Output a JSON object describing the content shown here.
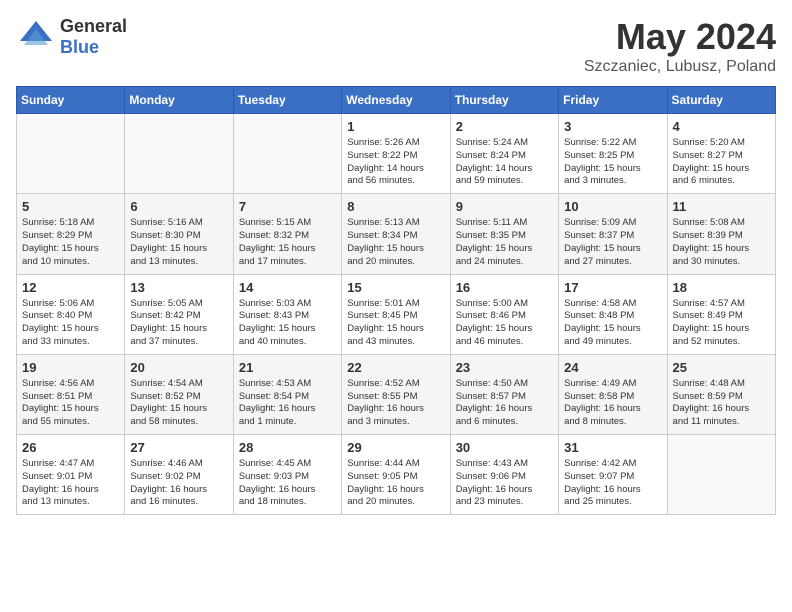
{
  "header": {
    "logo_general": "General",
    "logo_blue": "Blue",
    "title": "May 2024",
    "location": "Szczaniec, Lubusz, Poland"
  },
  "weekdays": [
    "Sunday",
    "Monday",
    "Tuesday",
    "Wednesday",
    "Thursday",
    "Friday",
    "Saturday"
  ],
  "weeks": [
    [
      {
        "day": "",
        "info": ""
      },
      {
        "day": "",
        "info": ""
      },
      {
        "day": "",
        "info": ""
      },
      {
        "day": "1",
        "info": "Sunrise: 5:26 AM\nSunset: 8:22 PM\nDaylight: 14 hours\nand 56 minutes."
      },
      {
        "day": "2",
        "info": "Sunrise: 5:24 AM\nSunset: 8:24 PM\nDaylight: 14 hours\nand 59 minutes."
      },
      {
        "day": "3",
        "info": "Sunrise: 5:22 AM\nSunset: 8:25 PM\nDaylight: 15 hours\nand 3 minutes."
      },
      {
        "day": "4",
        "info": "Sunrise: 5:20 AM\nSunset: 8:27 PM\nDaylight: 15 hours\nand 6 minutes."
      }
    ],
    [
      {
        "day": "5",
        "info": "Sunrise: 5:18 AM\nSunset: 8:29 PM\nDaylight: 15 hours\nand 10 minutes."
      },
      {
        "day": "6",
        "info": "Sunrise: 5:16 AM\nSunset: 8:30 PM\nDaylight: 15 hours\nand 13 minutes."
      },
      {
        "day": "7",
        "info": "Sunrise: 5:15 AM\nSunset: 8:32 PM\nDaylight: 15 hours\nand 17 minutes."
      },
      {
        "day": "8",
        "info": "Sunrise: 5:13 AM\nSunset: 8:34 PM\nDaylight: 15 hours\nand 20 minutes."
      },
      {
        "day": "9",
        "info": "Sunrise: 5:11 AM\nSunset: 8:35 PM\nDaylight: 15 hours\nand 24 minutes."
      },
      {
        "day": "10",
        "info": "Sunrise: 5:09 AM\nSunset: 8:37 PM\nDaylight: 15 hours\nand 27 minutes."
      },
      {
        "day": "11",
        "info": "Sunrise: 5:08 AM\nSunset: 8:39 PM\nDaylight: 15 hours\nand 30 minutes."
      }
    ],
    [
      {
        "day": "12",
        "info": "Sunrise: 5:06 AM\nSunset: 8:40 PM\nDaylight: 15 hours\nand 33 minutes."
      },
      {
        "day": "13",
        "info": "Sunrise: 5:05 AM\nSunset: 8:42 PM\nDaylight: 15 hours\nand 37 minutes."
      },
      {
        "day": "14",
        "info": "Sunrise: 5:03 AM\nSunset: 8:43 PM\nDaylight: 15 hours\nand 40 minutes."
      },
      {
        "day": "15",
        "info": "Sunrise: 5:01 AM\nSunset: 8:45 PM\nDaylight: 15 hours\nand 43 minutes."
      },
      {
        "day": "16",
        "info": "Sunrise: 5:00 AM\nSunset: 8:46 PM\nDaylight: 15 hours\nand 46 minutes."
      },
      {
        "day": "17",
        "info": "Sunrise: 4:58 AM\nSunset: 8:48 PM\nDaylight: 15 hours\nand 49 minutes."
      },
      {
        "day": "18",
        "info": "Sunrise: 4:57 AM\nSunset: 8:49 PM\nDaylight: 15 hours\nand 52 minutes."
      }
    ],
    [
      {
        "day": "19",
        "info": "Sunrise: 4:56 AM\nSunset: 8:51 PM\nDaylight: 15 hours\nand 55 minutes."
      },
      {
        "day": "20",
        "info": "Sunrise: 4:54 AM\nSunset: 8:52 PM\nDaylight: 15 hours\nand 58 minutes."
      },
      {
        "day": "21",
        "info": "Sunrise: 4:53 AM\nSunset: 8:54 PM\nDaylight: 16 hours\nand 1 minute."
      },
      {
        "day": "22",
        "info": "Sunrise: 4:52 AM\nSunset: 8:55 PM\nDaylight: 16 hours\nand 3 minutes."
      },
      {
        "day": "23",
        "info": "Sunrise: 4:50 AM\nSunset: 8:57 PM\nDaylight: 16 hours\nand 6 minutes."
      },
      {
        "day": "24",
        "info": "Sunrise: 4:49 AM\nSunset: 8:58 PM\nDaylight: 16 hours\nand 8 minutes."
      },
      {
        "day": "25",
        "info": "Sunrise: 4:48 AM\nSunset: 8:59 PM\nDaylight: 16 hours\nand 11 minutes."
      }
    ],
    [
      {
        "day": "26",
        "info": "Sunrise: 4:47 AM\nSunset: 9:01 PM\nDaylight: 16 hours\nand 13 minutes."
      },
      {
        "day": "27",
        "info": "Sunrise: 4:46 AM\nSunset: 9:02 PM\nDaylight: 16 hours\nand 16 minutes."
      },
      {
        "day": "28",
        "info": "Sunrise: 4:45 AM\nSunset: 9:03 PM\nDaylight: 16 hours\nand 18 minutes."
      },
      {
        "day": "29",
        "info": "Sunrise: 4:44 AM\nSunset: 9:05 PM\nDaylight: 16 hours\nand 20 minutes."
      },
      {
        "day": "30",
        "info": "Sunrise: 4:43 AM\nSunset: 9:06 PM\nDaylight: 16 hours\nand 23 minutes."
      },
      {
        "day": "31",
        "info": "Sunrise: 4:42 AM\nSunset: 9:07 PM\nDaylight: 16 hours\nand 25 minutes."
      },
      {
        "day": "",
        "info": ""
      }
    ]
  ]
}
